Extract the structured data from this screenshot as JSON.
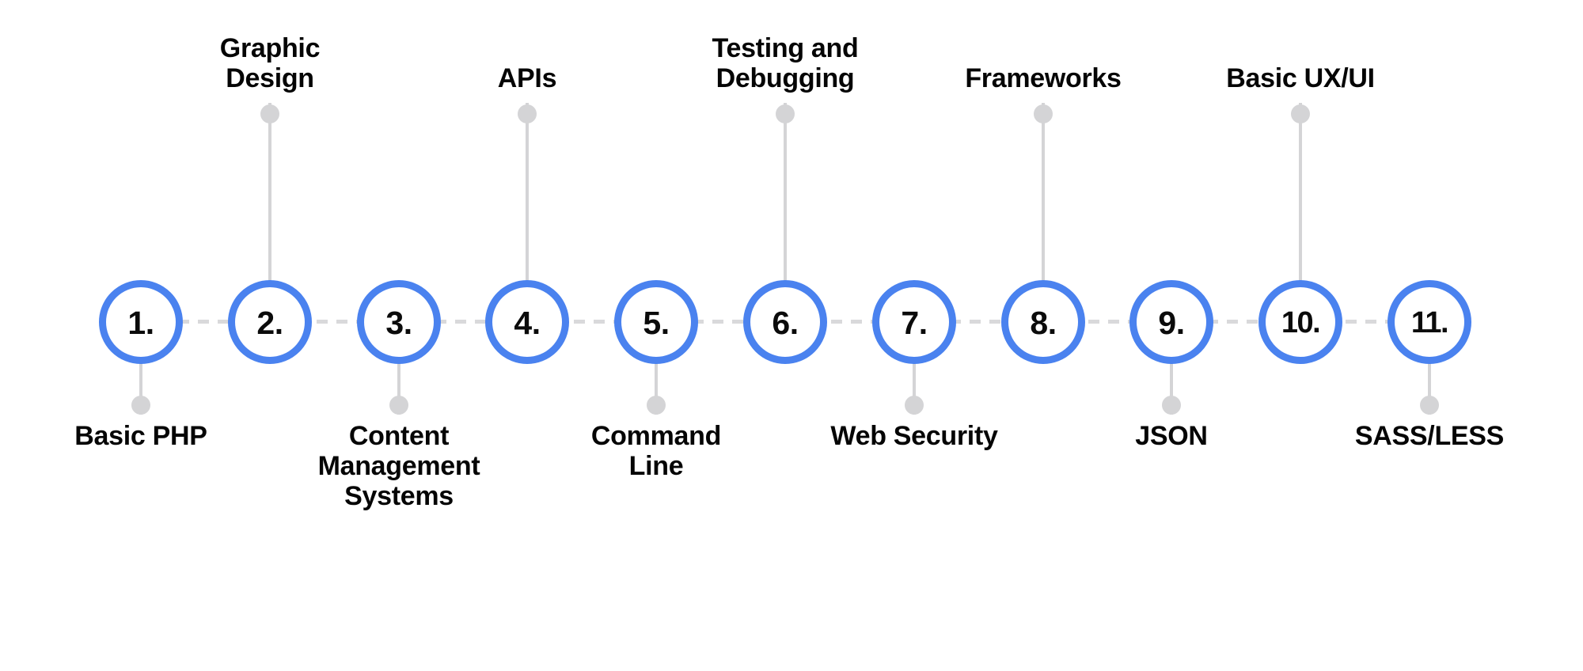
{
  "diagram": {
    "type": "numbered-roadmap-timeline",
    "orientation": "horizontal",
    "background_color": "#ffffff",
    "node_color": "#4a82ef",
    "connector_color": "#d4d4d6",
    "number_color": "#0b0b0b",
    "label_color": "#050505",
    "step_count": 11
  },
  "steps": [
    {
      "number": "1.",
      "label": "Basic PHP",
      "label_position": "below"
    },
    {
      "number": "2.",
      "label": "Graphic Design",
      "label_position": "above"
    },
    {
      "number": "3.",
      "label": "Content Management Systems",
      "label_position": "below"
    },
    {
      "number": "4.",
      "label": "APIs",
      "label_position": "above"
    },
    {
      "number": "5.",
      "label": "Command Line",
      "label_position": "below"
    },
    {
      "number": "6.",
      "label": "Testing and Debugging",
      "label_position": "above"
    },
    {
      "number": "7.",
      "label": "Web Security",
      "label_position": "below"
    },
    {
      "number": "8.",
      "label": "Frameworks",
      "label_position": "above"
    },
    {
      "number": "9.",
      "label": "JSON",
      "label_position": "below"
    },
    {
      "number": "10.",
      "label": "Basic UX/UI",
      "label_position": "above"
    },
    {
      "number": "11.",
      "label": "SASS/LESS",
      "label_position": "below"
    }
  ]
}
